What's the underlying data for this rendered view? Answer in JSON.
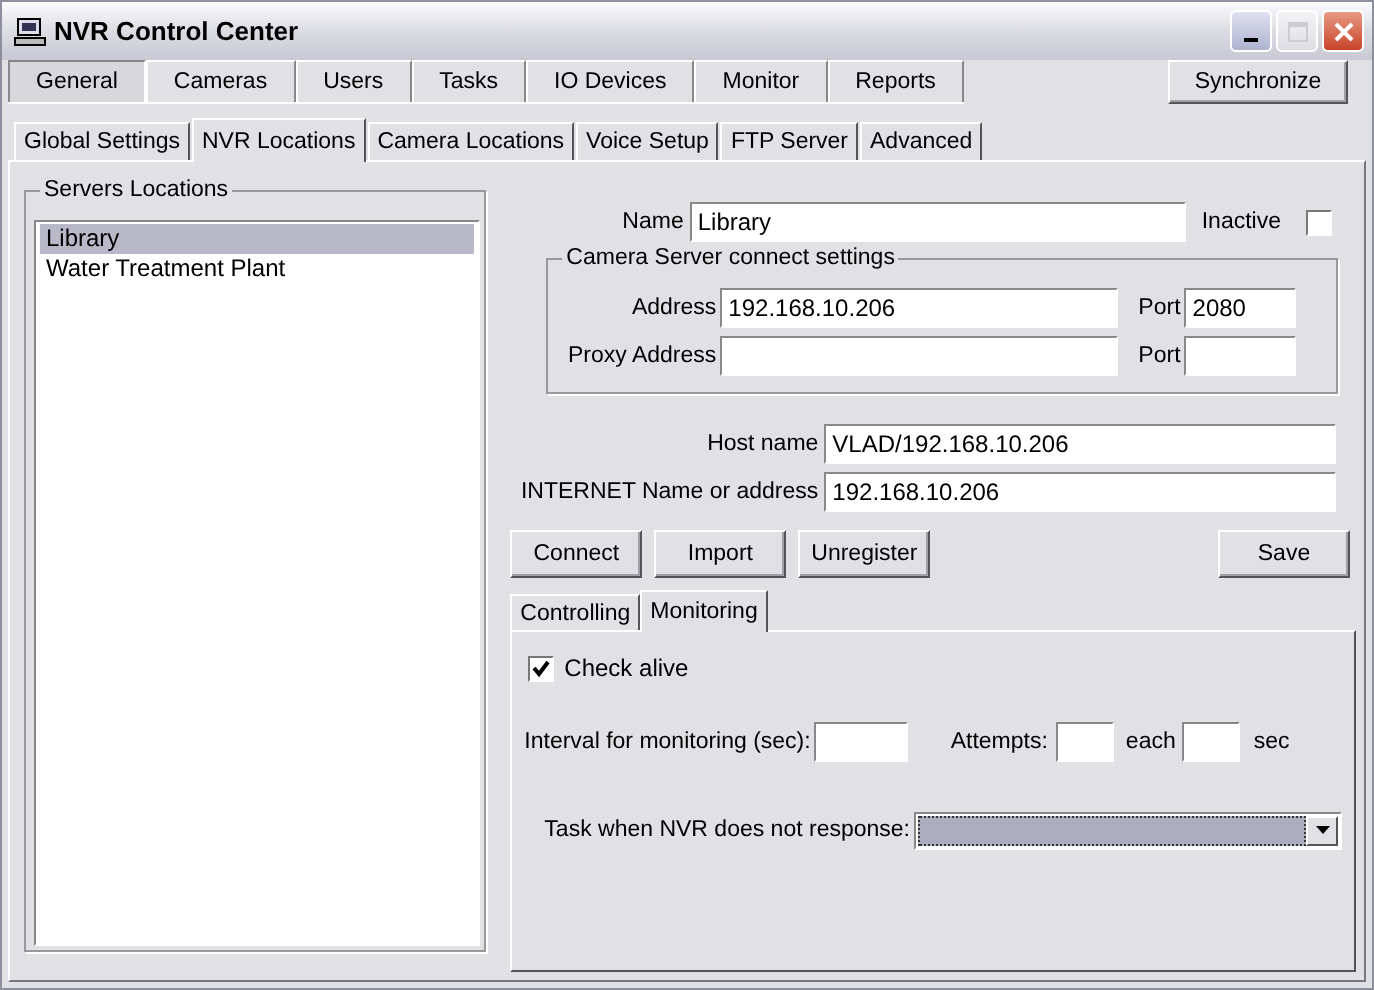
{
  "window": {
    "title": "NVR Control Center"
  },
  "main_tabs": [
    {
      "label": "General",
      "selected": true
    },
    {
      "label": "Cameras",
      "selected": false
    },
    {
      "label": "Users",
      "selected": false
    },
    {
      "label": "Tasks",
      "selected": false
    },
    {
      "label": "IO Devices",
      "selected": false
    },
    {
      "label": "Monitor",
      "selected": false
    },
    {
      "label": "Reports",
      "selected": false
    }
  ],
  "synchronize_button": "Synchronize",
  "sub_tabs": [
    {
      "label": "Global Settings",
      "selected": false
    },
    {
      "label": "NVR Locations",
      "selected": true
    },
    {
      "label": "Camera Locations",
      "selected": false
    },
    {
      "label": "Voice Setup",
      "selected": false
    },
    {
      "label": "FTP Server",
      "selected": false
    },
    {
      "label": "Advanced",
      "selected": false
    }
  ],
  "servers_locations": {
    "title": "Servers Locations",
    "items": [
      {
        "label": "Library",
        "selected": true
      },
      {
        "label": "Water Treatment Plant",
        "selected": false
      }
    ]
  },
  "name": {
    "label": "Name",
    "value": "Library"
  },
  "inactive": {
    "label": "Inactive",
    "checked": false
  },
  "camera_server": {
    "title": "Camera Server connect settings",
    "address": {
      "label": "Address",
      "value": "192.168.10.206"
    },
    "port": {
      "label": "Port",
      "value": "2080"
    },
    "proxy_address": {
      "label": "Proxy Address"
    },
    "proxy_port": {
      "label": "Port"
    }
  },
  "host_name": {
    "label": "Host name",
    "value": "VLAD/192.168.10.206"
  },
  "internet_name": {
    "label": "INTERNET Name or address",
    "value": "192.168.10.206"
  },
  "buttons": [
    "Connect",
    "Import",
    "Unregister"
  ],
  "save_button": "Save",
  "inner_tabs": [
    {
      "label": "Controlling",
      "selected": false
    },
    {
      "label": "Monitoring",
      "selected": true
    }
  ],
  "monitoring": {
    "check_alive": {
      "label": "Check alive",
      "checked": true
    },
    "interval_label": "Interval for monitoring (sec):",
    "attempts_label": "Attempts:",
    "each_label": "each",
    "sec_label": "sec",
    "task_label": "Task when NVR does not response:"
  }
}
